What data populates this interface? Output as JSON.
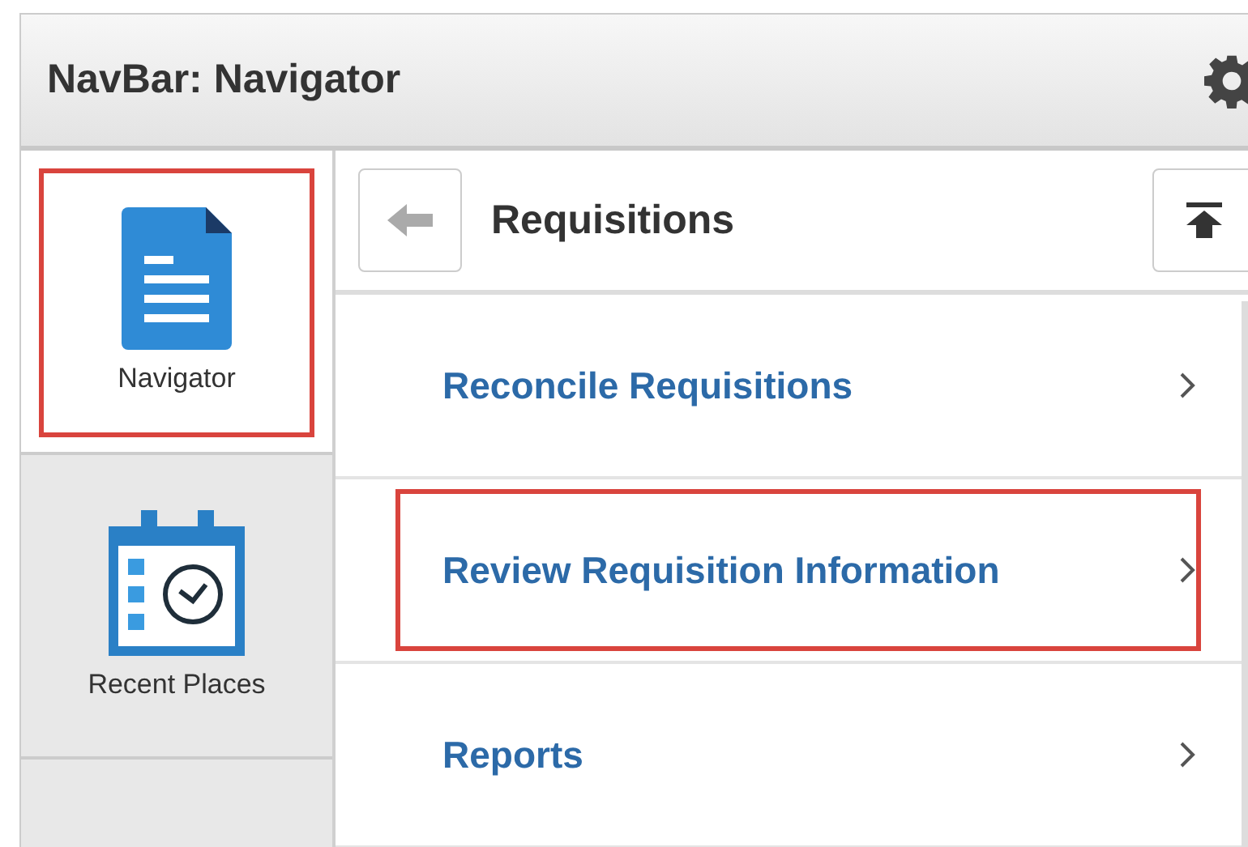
{
  "header": {
    "title": "NavBar: Navigator"
  },
  "tiles": [
    {
      "kind": "document",
      "label": "Navigator",
      "selected": true,
      "highlighted": true
    },
    {
      "kind": "calendar",
      "label": "Recent Places",
      "selected": false,
      "highlighted": false
    }
  ],
  "panel": {
    "title": "Requisitions"
  },
  "items": [
    {
      "label": "Reconcile Requisitions",
      "highlighted": false
    },
    {
      "label": "Review Requisition Information",
      "highlighted": true
    },
    {
      "label": "Reports",
      "highlighted": false
    }
  ]
}
